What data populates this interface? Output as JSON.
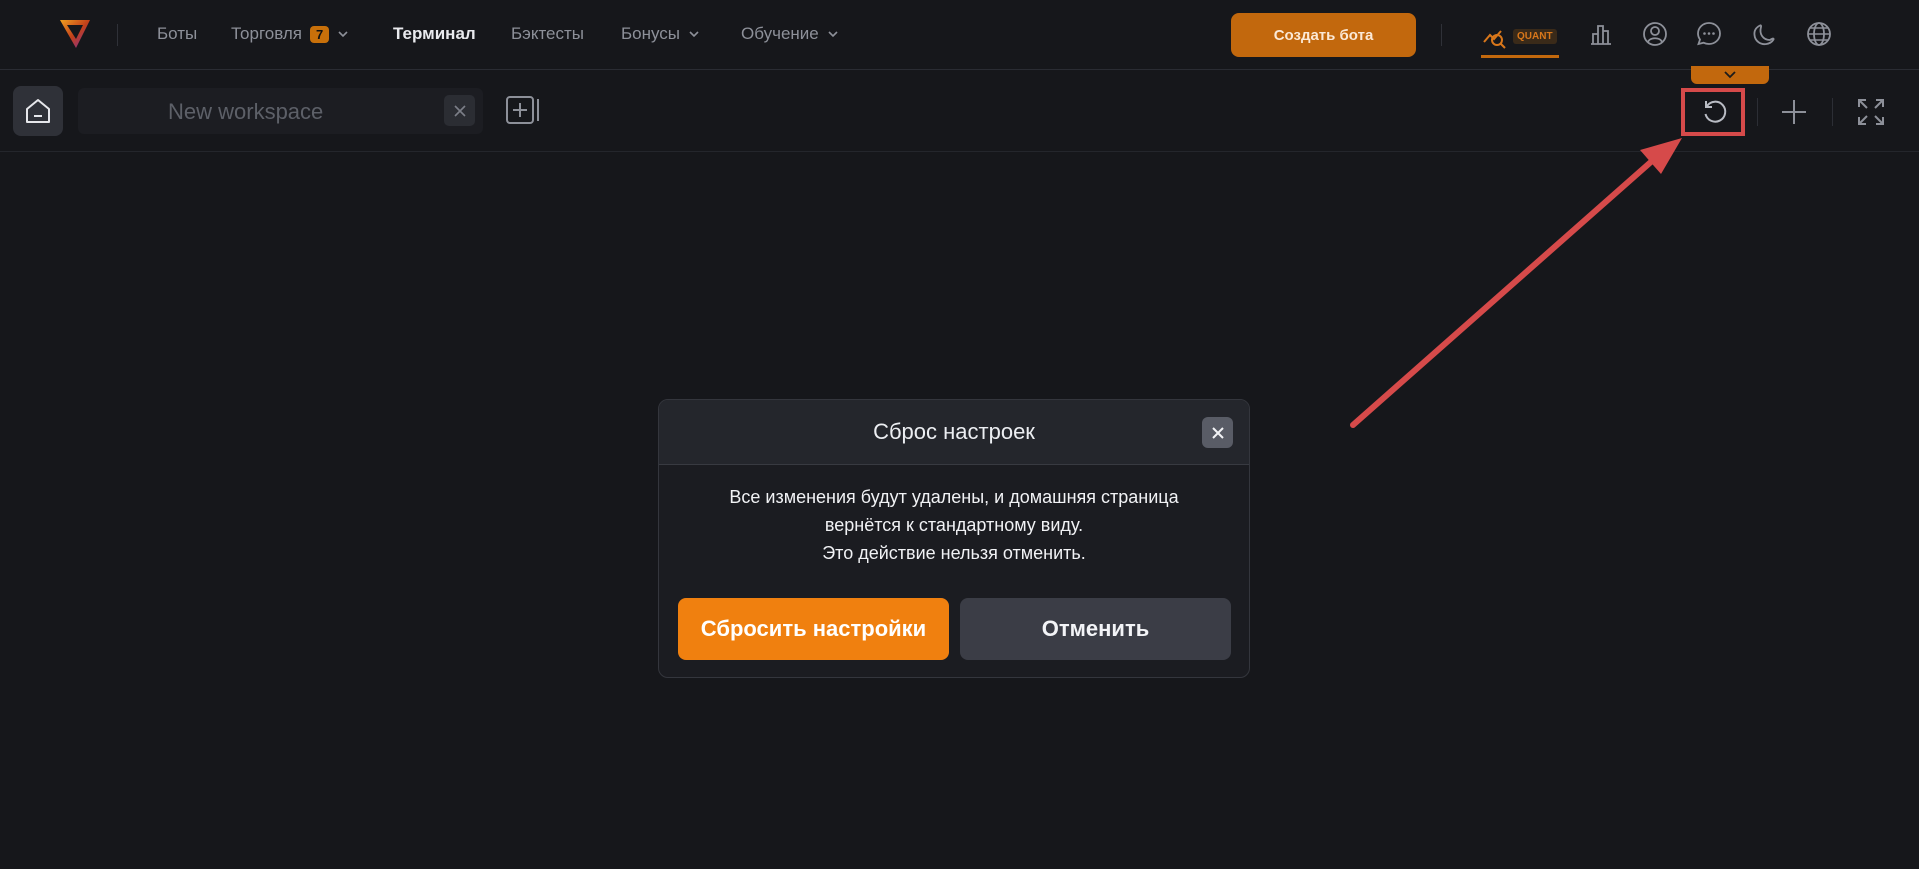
{
  "nav": {
    "items": [
      {
        "label": "Боты"
      },
      {
        "label": "Торговля",
        "badge": "7"
      },
      {
        "label": "Терминал"
      },
      {
        "label": "Бэктесты"
      },
      {
        "label": "Бонусы"
      },
      {
        "label": "Обучение"
      }
    ],
    "create_bot_label": "Создать бота",
    "quant_label": "QUANT"
  },
  "workspace": {
    "tab_name": "New workspace"
  },
  "modal": {
    "title": "Сброс настроек",
    "line1": "Все изменения будут удалены, и домашняя страница",
    "line2": "вернётся к стандартному виду.",
    "line3": "Это действие нельзя отменить.",
    "confirm_label": "Сбросить настройки",
    "cancel_label": "Отменить"
  },
  "colors": {
    "accent": "#f0800f",
    "background": "#16171b",
    "highlight": "#d64a4a"
  }
}
